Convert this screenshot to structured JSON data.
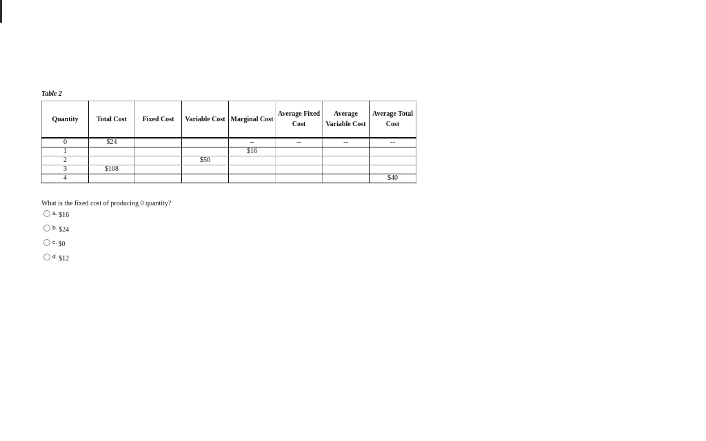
{
  "table": {
    "caption": "Table 2",
    "headers": [
      "Quantity",
      "Total Cost",
      "Fixed Cost",
      "Variable Cost",
      "Marginal Cost",
      "Average Fixed Cost",
      "Average Variable Cost",
      "Average Total Cost"
    ],
    "rows": [
      [
        "0",
        "$24",
        "",
        "",
        "--",
        "--",
        "--",
        "--"
      ],
      [
        "1",
        "",
        "",
        "",
        "$16",
        "",
        "",
        ""
      ],
      [
        "2",
        "",
        "",
        "$50",
        "",
        "",
        "",
        ""
      ],
      [
        "3",
        "$108",
        "",
        "",
        "",
        "",
        "",
        ""
      ],
      [
        "4",
        "",
        "",
        "",
        "",
        "",
        "",
        "$40"
      ]
    ]
  },
  "question": {
    "text": "What is the fixed cost of producing 0 quantity?",
    "options": [
      {
        "letter": "a.",
        "text": "$16"
      },
      {
        "letter": "b.",
        "text": "$24"
      },
      {
        "letter": "c.",
        "text": "$0"
      },
      {
        "letter": "d.",
        "text": "$12"
      }
    ]
  }
}
